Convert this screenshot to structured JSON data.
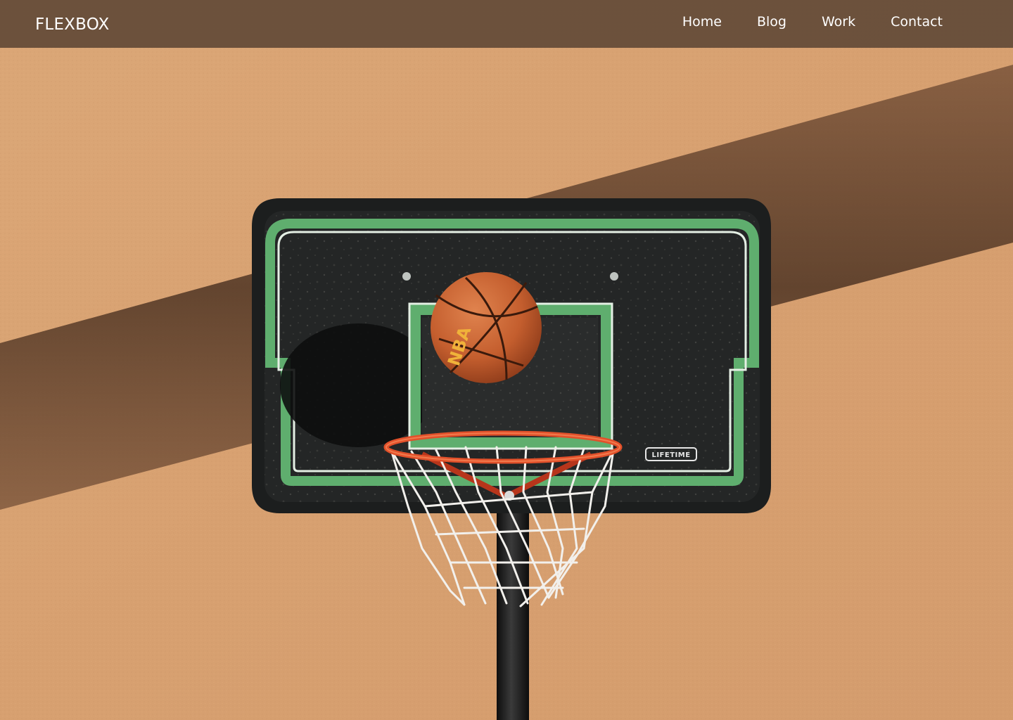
{
  "header": {
    "brand": "FLEXBOX",
    "nav": [
      {
        "label": "Home"
      },
      {
        "label": "Blog"
      },
      {
        "label": "Work"
      },
      {
        "label": "Contact"
      }
    ]
  },
  "hero": {
    "ball_text": "NBA",
    "backboard_brand": "LIFETIME"
  },
  "colors": {
    "navbar_bg": "#5c4634",
    "nav_text": "#ffffff",
    "wall": "#d9a474",
    "backboard": "#1f2121",
    "backboard_stripe": "#5fae6e",
    "rim": "#e2502a",
    "ball": "#c8612f"
  }
}
